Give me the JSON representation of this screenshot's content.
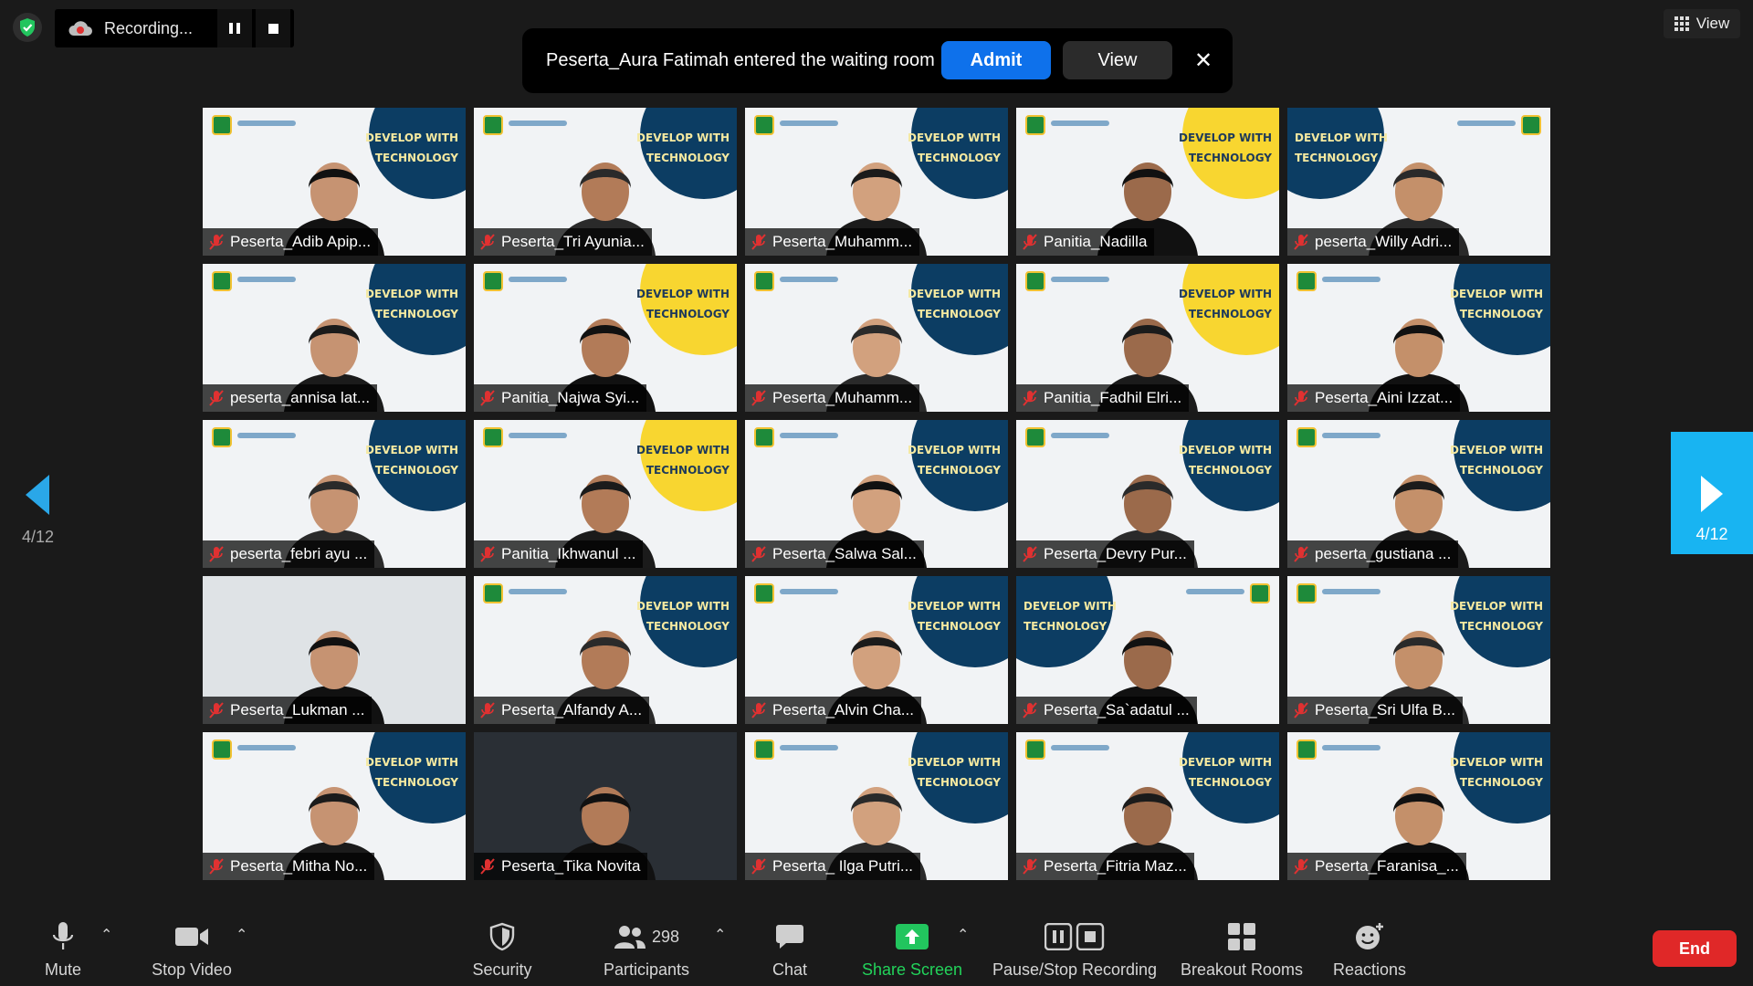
{
  "recording": {
    "label": "Recording..."
  },
  "notification": {
    "message": "Peserta_Aura Fatimah entered the waiting room",
    "admit_label": "Admit",
    "view_label": "View",
    "close_label": "✕"
  },
  "view_top": {
    "label": "View"
  },
  "paging": {
    "left_count": "4/12",
    "right_count": "4/12"
  },
  "banner": {
    "line1": "DEVELOP WITH",
    "line2": "TECHNOLOGY"
  },
  "participants": [
    {
      "name": "Peserta_Adib Apip...",
      "variant": "navy"
    },
    {
      "name": "Peserta_Tri Ayunia...",
      "variant": "navy"
    },
    {
      "name": "Peserta_Muhamm...",
      "variant": "navy"
    },
    {
      "name": "Panitia_Nadilla",
      "variant": "yellow"
    },
    {
      "name": "peserta_Willy Adri...",
      "variant": "mirror"
    },
    {
      "name": "peserta_annisa lat...",
      "variant": "navy"
    },
    {
      "name": "Panitia_Najwa Syi...",
      "variant": "yellow"
    },
    {
      "name": "Peserta_Muhamm...",
      "variant": "navy"
    },
    {
      "name": "Panitia_Fadhil Elri...",
      "variant": "yellow"
    },
    {
      "name": "Peserta_Aini Izzat...",
      "variant": "navy"
    },
    {
      "name": "peserta_febri ayu ...",
      "variant": "navy"
    },
    {
      "name": "Panitia_Ikhwanul ...",
      "variant": "yellow"
    },
    {
      "name": "Peserta_Salwa Sal...",
      "variant": "navy"
    },
    {
      "name": "Peserta_Devry Pur...",
      "variant": "navy"
    },
    {
      "name": "peserta_gustiana ...",
      "variant": "navy"
    },
    {
      "name": "Peserta_Lukman ...",
      "variant": "plain"
    },
    {
      "name": "Peserta_Alfandy A...",
      "variant": "navy"
    },
    {
      "name": "Peserta_Alvin Cha...",
      "variant": "navy"
    },
    {
      "name": "Peserta_Sa`adatul ...",
      "variant": "mirror"
    },
    {
      "name": "Peserta_Sri Ulfa B...",
      "variant": "navy"
    },
    {
      "name": "Peserta_Mitha No...",
      "variant": "navy"
    },
    {
      "name": "Peserta_Tika Novita",
      "variant": "dark"
    },
    {
      "name": "Peserta_ Ilga Putri...",
      "variant": "navy"
    },
    {
      "name": "Peserta_Fitria Maz...",
      "variant": "navy"
    },
    {
      "name": "Peserta_Faranisa_...",
      "variant": "navy"
    }
  ],
  "toolbar": {
    "mute": "Mute",
    "stop_video": "Stop Video",
    "security": "Security",
    "participants": "Participants",
    "participants_count": "298",
    "chat": "Chat",
    "share_screen": "Share Screen",
    "pause_stop_recording": "Pause/Stop Recording",
    "breakout_rooms": "Breakout Rooms",
    "reactions": "Reactions",
    "end": "End"
  },
  "colors": {
    "admit_blue": "#0e71eb",
    "share_green": "#22d35a",
    "end_red": "#e02828",
    "paging_blue": "#18b4f2",
    "banner_navy": "#0c3d63",
    "banner_yellow": "#f8d630"
  }
}
